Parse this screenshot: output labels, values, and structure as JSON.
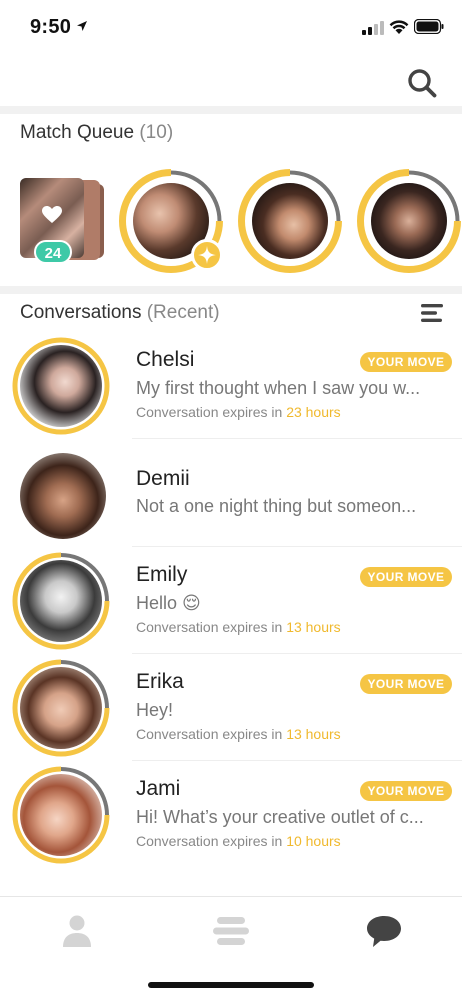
{
  "status_bar": {
    "time": "9:50"
  },
  "match_queue": {
    "title": "Match Queue",
    "count": "(10)",
    "stack_badge": "24"
  },
  "conversations": {
    "title": "Conversations",
    "subtitle": "(Recent)",
    "items": [
      {
        "name": "Chelsi",
        "preview": "My first thought when I saw you w...",
        "expires_prefix": "Conversation expires in",
        "expires_hours": "23 hours",
        "badge": "YOUR MOVE"
      },
      {
        "name": "Demii",
        "preview": "Not a one night thing but someon..."
      },
      {
        "name": "Emily",
        "preview": "Hello 😌",
        "expires_prefix": "Conversation expires in",
        "expires_hours": "13 hours",
        "badge": "YOUR MOVE"
      },
      {
        "name": "Erika",
        "preview": "Hey!",
        "expires_prefix": "Conversation expires in",
        "expires_hours": "13 hours",
        "badge": "YOUR MOVE"
      },
      {
        "name": "Jami",
        "preview": "Hi! What’s your creative outlet of c...",
        "expires_prefix": "Conversation expires in",
        "expires_hours": "10 hours",
        "badge": "YOUR MOVE"
      }
    ]
  },
  "colors": {
    "accent": "#f5c544",
    "badge_green": "#3ec9a7",
    "ring_gray": "#777777"
  },
  "tab_bar": {
    "tabs": [
      "profile-icon",
      "discover-icon",
      "chat-icon"
    ]
  }
}
